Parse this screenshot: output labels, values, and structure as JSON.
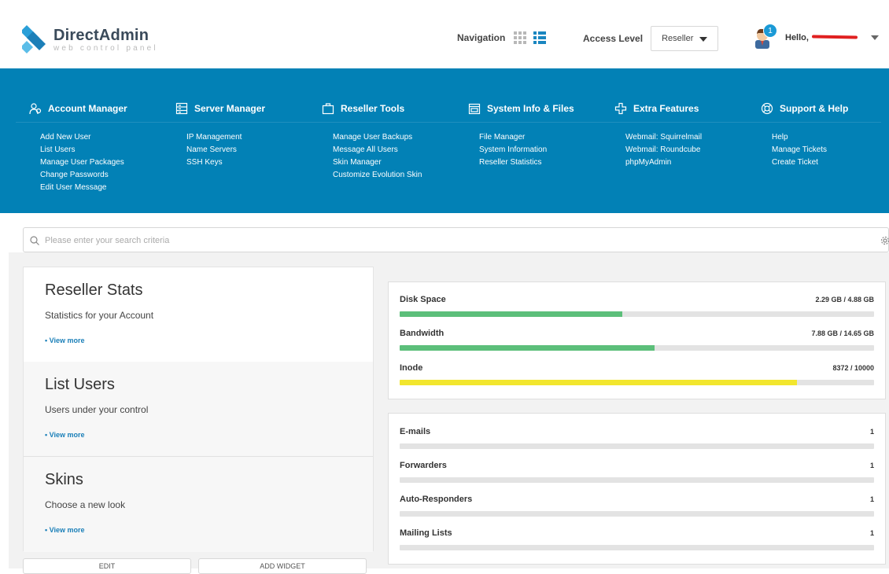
{
  "brand": {
    "name": "DirectAdmin",
    "tagline": "web control panel",
    "accent": "#0281b6"
  },
  "header": {
    "navigation_label": "Navigation",
    "access_level_label": "Access Level",
    "access_level_value": "Reseller",
    "notification_count": "1",
    "greeting": "Hello, "
  },
  "nav": {
    "columns": [
      {
        "title": "Account Manager",
        "icon": "users-icon",
        "items": [
          "Add New User",
          "List Users",
          "Manage User Packages",
          "Change Passwords",
          "Edit User Message"
        ]
      },
      {
        "title": "Server Manager",
        "icon": "server-icon",
        "items": [
          "IP Management",
          "Name Servers",
          "SSH Keys"
        ]
      },
      {
        "title": "Reseller Tools",
        "icon": "briefcase-icon",
        "items": [
          "Manage User Backups",
          "Message All Users",
          "Skin Manager",
          "Customize Evolution Skin"
        ]
      },
      {
        "title": "System Info & Files",
        "icon": "folder-window-icon",
        "items": [
          "File Manager",
          "System Information",
          "Reseller Statistics"
        ]
      },
      {
        "title": "Extra Features",
        "icon": "plus-icon",
        "items": [
          "Webmail: Squirrelmail",
          "Webmail: Roundcube",
          "phpMyAdmin"
        ]
      },
      {
        "title": "Support & Help",
        "icon": "lifebuoy-icon",
        "items": [
          "Help",
          "Manage Tickets",
          "Create Ticket"
        ]
      }
    ]
  },
  "search": {
    "placeholder": "Please enter your search criteria"
  },
  "sections": [
    {
      "title": "Reseller Stats",
      "desc": "Statistics for your Account",
      "link": "• View more"
    },
    {
      "title": "List Users",
      "desc": "Users under your control",
      "link": "• View more"
    },
    {
      "title": "Skins",
      "desc": "Choose a new look",
      "link": "• View more"
    }
  ],
  "bottom_buttons": [
    "EDIT",
    "ADD WIDGET"
  ],
  "usage": [
    {
      "name": "Disk Space",
      "value": "2.29 GB / 4.88 GB",
      "fraction": 0.469,
      "color": "#5cbf7a"
    },
    {
      "name": "Bandwidth",
      "value": "7.88 GB / 14.65 GB",
      "fraction": 0.538,
      "color": "#5cbf7a"
    },
    {
      "name": "Inode",
      "value": "8372 / 10000",
      "fraction": 0.837,
      "color": "#f2e62e"
    }
  ],
  "counts": [
    {
      "name": "E-mails",
      "value": "1"
    },
    {
      "name": "Forwarders",
      "value": "1"
    },
    {
      "name": "Auto-Responders",
      "value": "1"
    },
    {
      "name": "Mailing Lists",
      "value": "1"
    }
  ]
}
